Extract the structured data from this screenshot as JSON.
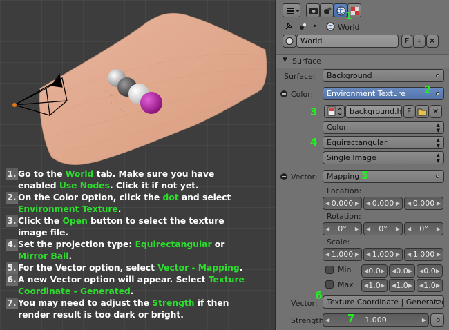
{
  "instructions": [
    {
      "num": "1.",
      "parts": [
        {
          "t": "Go to the "
        },
        {
          "t": "World",
          "hl": true
        },
        {
          "t": " tab. Make sure you have"
        }
      ],
      "cont": [
        {
          "t": "enabled "
        },
        {
          "t": "Use Nodes",
          "hl": true
        },
        {
          "t": ". Click it if not yet."
        }
      ]
    },
    {
      "num": "2.",
      "parts": [
        {
          "t": "On the Color Option, click the "
        },
        {
          "t": "dot",
          "hl": true
        },
        {
          "t": " and select"
        }
      ],
      "cont": [
        {
          "t": "Environment Texture",
          "hl": true
        },
        {
          "t": "."
        }
      ]
    },
    {
      "num": "3.",
      "parts": [
        {
          "t": "Click the "
        },
        {
          "t": "Open",
          "hl": true
        },
        {
          "t": " button to select the texture"
        }
      ],
      "cont": [
        {
          "t": "image file."
        }
      ]
    },
    {
      "num": "4.",
      "parts": [
        {
          "t": "Set the projection type: "
        },
        {
          "t": "Equirectangular",
          "hl": true
        },
        {
          "t": " or"
        }
      ],
      "cont": [
        {
          "t": "Mirror Ball",
          "hl": true
        },
        {
          "t": "."
        }
      ]
    },
    {
      "num": "5.",
      "parts": [
        {
          "t": "For the Vector option, select "
        },
        {
          "t": "Vector - Mapping",
          "hl": true
        },
        {
          "t": "."
        }
      ],
      "cont": null
    },
    {
      "num": "6.",
      "parts": [
        {
          "t": "A new Vector option will appear. Select "
        },
        {
          "t": "Texture",
          "hl": true
        }
      ],
      "cont": [
        {
          "t": "Coordinate - Generated",
          "hl": true
        },
        {
          "t": "."
        }
      ]
    },
    {
      "num": "7.",
      "parts": [
        {
          "t": "You may need to adjust the "
        },
        {
          "t": "Strength",
          "hl": true
        },
        {
          "t": " if then"
        }
      ],
      "cont": [
        {
          "t": "render result is too dark or bright."
        }
      ]
    }
  ],
  "panel": {
    "breadcrumb": "World",
    "world_name": "World",
    "world_f": "F",
    "section_title": "Surface",
    "surface_label": "Surface:",
    "surface_value": "Background",
    "color_label": "Color:",
    "color_value": "Environment Texture",
    "image_file": "background.hdr",
    "image_f": "F",
    "color_space": "Color",
    "projection": "Equirectangular",
    "image_mode": "Single Image",
    "vector_label": "Vector:",
    "vector_value": "Mapping",
    "location_label": "Location:",
    "location": [
      "0.000",
      "0.000",
      "0.000"
    ],
    "rotation_label": "Rotation:",
    "rotation": [
      "0°",
      "0°",
      "0°"
    ],
    "scale_label": "Scale:",
    "scale": [
      "1.000",
      "1.000",
      "1.000"
    ],
    "min_label": "Min",
    "min": [
      "0.0",
      "0.0",
      "0.0"
    ],
    "max_label": "Max",
    "max": [
      "1.0",
      "1.0",
      "1.0"
    ],
    "vector2_label": "Vector:",
    "vector2_value": "Texture Coordinate | Generated",
    "strength_label": "Strength:",
    "strength_value": "1.000"
  },
  "callouts": [
    "1",
    "2",
    "3",
    "4",
    "5",
    "6",
    "7"
  ],
  "colors": {
    "highlight": "#2ddd2d",
    "panel_bg": "#727272",
    "selected_menu": "#5b7db5"
  }
}
